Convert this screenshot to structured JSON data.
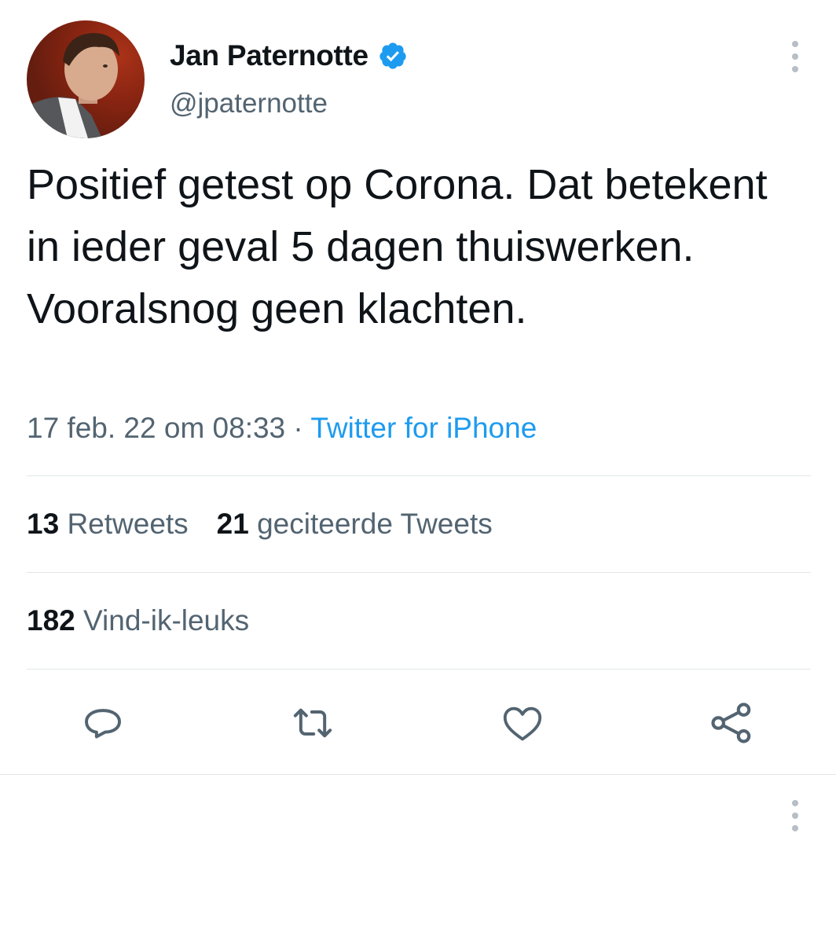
{
  "author": {
    "name": "Jan Paternotte",
    "handle": "@jpaternotte",
    "verified": true,
    "verified_color": "#1d9bf0"
  },
  "tweet": {
    "text": "Positief getest op Corona. Dat betekent in ieder geval 5 dagen thuiswerken. Vooralsnog geen klachten.",
    "date": "17 feb. 22 om 08:33",
    "separator": "·",
    "source": "Twitter for iPhone"
  },
  "stats": {
    "retweets_count": "13",
    "retweets_label": "Retweets",
    "quotes_count": "21",
    "quotes_label": "geciteerde Tweets",
    "likes_count": "182",
    "likes_label": "Vind-ik-leuks"
  },
  "actions": [
    "reply-icon",
    "retweet-icon",
    "like-icon",
    "share-icon"
  ],
  "colors": {
    "text": "#0f1419",
    "secondary": "#536471",
    "link": "#1d9bf0",
    "divider": "#e2e6e9"
  }
}
